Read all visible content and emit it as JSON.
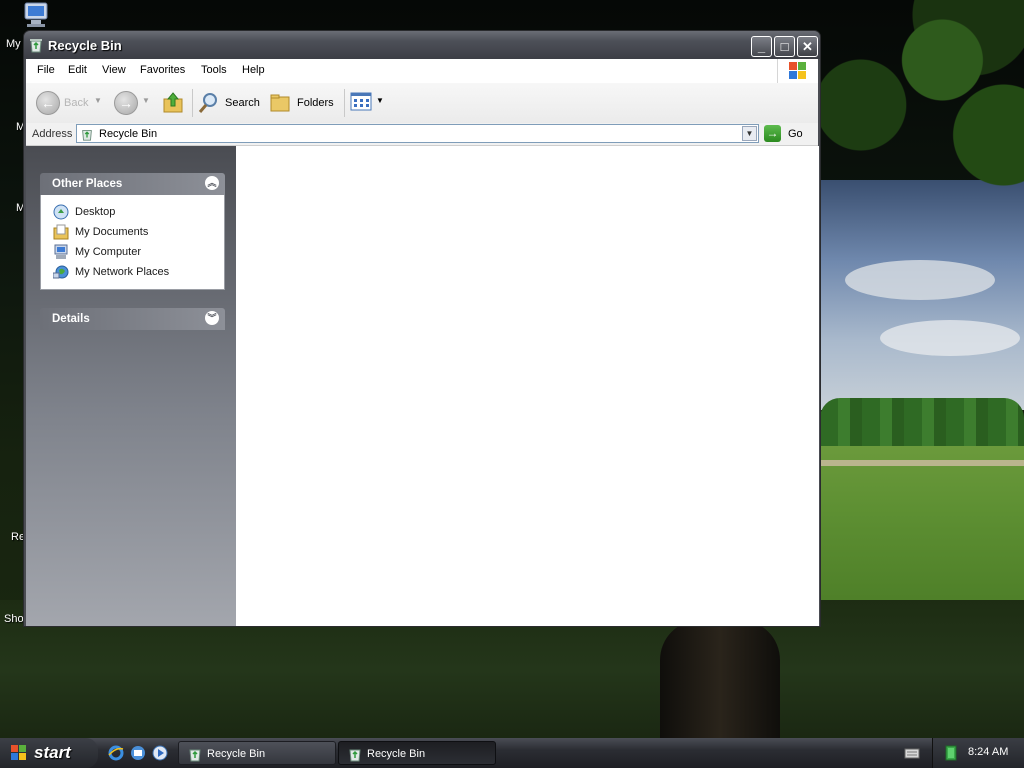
{
  "desktop": {
    "icon_labels": [
      "My",
      "My",
      "M",
      "Re",
      "Sho"
    ]
  },
  "window": {
    "title": "Recycle Bin",
    "buttons": {
      "minimize": "_",
      "maximize": "□",
      "close": "✕"
    }
  },
  "menubar": {
    "items": [
      "File",
      "Edit",
      "View",
      "Favorites",
      "Tools",
      "Help"
    ]
  },
  "toolbar": {
    "back": "Back",
    "search": "Search",
    "folders": "Folders"
  },
  "address": {
    "label": "Address",
    "value": "Recycle Bin",
    "go": "Go"
  },
  "taskpane": {
    "other_places": {
      "title": "Other Places",
      "items": [
        "Desktop",
        "My Documents",
        "My Computer",
        "My Network Places"
      ]
    },
    "details": {
      "title": "Details"
    }
  },
  "taskbar": {
    "start": "start",
    "buttons": [
      "Recycle Bin",
      "Recycle Bin"
    ],
    "clock": "8:24 AM"
  },
  "colors": {
    "title_bar": "#4d5058",
    "taskpane": "#4a4c52",
    "go_green": "#2b8a1f"
  }
}
